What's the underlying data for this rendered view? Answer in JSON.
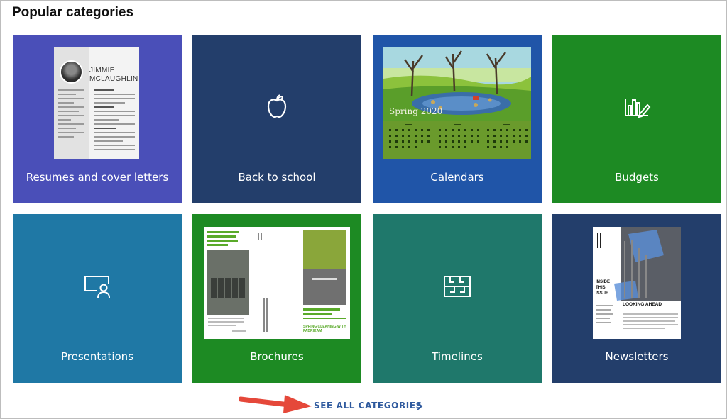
{
  "page": {
    "title": "Popular categories"
  },
  "tiles": [
    {
      "label": "Resumes and cover letters",
      "color": "#4a4fb8"
    },
    {
      "label": "Back to school",
      "color": "#233e6b"
    },
    {
      "label": "Calendars",
      "color": "#2055a8"
    },
    {
      "label": "Budgets",
      "color": "#1d8a23"
    },
    {
      "label": "Presentations",
      "color": "#1f78a5"
    },
    {
      "label": "Brochures",
      "color": "#1d8a23"
    },
    {
      "label": "Timelines",
      "color": "#1f786b"
    },
    {
      "label": "Newsletters",
      "color": "#233e6b"
    }
  ],
  "thumbnails": {
    "resume": {
      "name_line1": "JIMMIE",
      "name_line2": "MCLAUGHLIN"
    },
    "calendar": {
      "caption": "Spring 2020"
    },
    "brochure": {
      "headline": "SPRING CLEANING WITH FABRIKAM"
    },
    "newsletter": {
      "issue_label": "INSIDE THIS ISSUE",
      "feature": "LOOKING AHEAD"
    }
  },
  "icons": {
    "back_to_school": "apple-icon",
    "budgets": "bar-chart-pencil-icon",
    "presentations": "screen-person-icon",
    "timelines": "timeline-grid-icon",
    "see_all": "chevron-right-icon",
    "annotation": "red-arrow-icon"
  },
  "footer": {
    "see_all_label": "SEE ALL CATEGORIES"
  },
  "accent": {
    "link": "#2f5a9e",
    "arrow": "#e5483a"
  }
}
